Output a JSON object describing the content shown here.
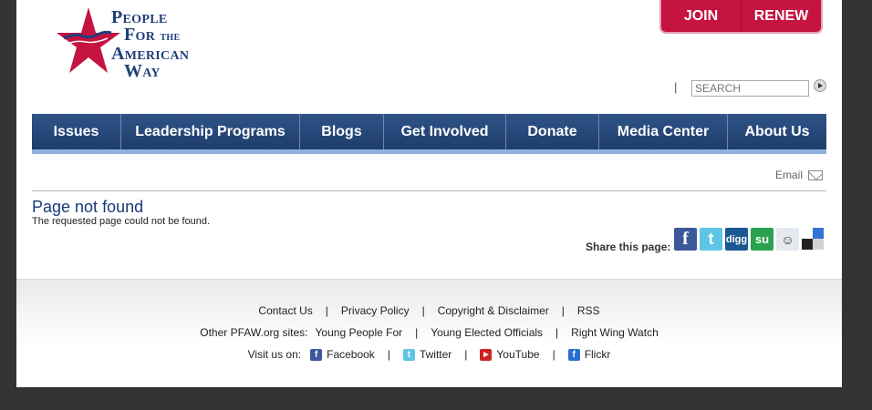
{
  "brand": {
    "line1": "People",
    "line2": "For",
    "line2b": "the",
    "line3": "American",
    "line4": "Way"
  },
  "header": {
    "join_label": "JOIN",
    "renew_label": "RENEW",
    "pipe": "|",
    "search_placeholder": "SEARCH"
  },
  "nav": {
    "items": [
      {
        "label": "Issues"
      },
      {
        "label": "Leadership Programs"
      },
      {
        "label": "Blogs"
      },
      {
        "label": "Get Involved"
      },
      {
        "label": "Donate"
      },
      {
        "label": "Media Center"
      },
      {
        "label": "About Us"
      }
    ]
  },
  "tools": {
    "email_label": "Email"
  },
  "main": {
    "title": "Page not found",
    "message": "The requested page could not be found.",
    "share_label": "Share this page:"
  },
  "share_icons": [
    {
      "name": "facebook-share-icon",
      "glyph": "f"
    },
    {
      "name": "twitter-share-icon",
      "glyph": "t"
    },
    {
      "name": "digg-share-icon",
      "glyph": "digg"
    },
    {
      "name": "stumbleupon-share-icon",
      "glyph": "su"
    },
    {
      "name": "reddit-share-icon",
      "glyph": "☺"
    },
    {
      "name": "delicious-share-icon",
      "glyph": ""
    }
  ],
  "footer": {
    "links": [
      "Contact Us",
      "Privacy Policy",
      "Copyright & Disclaimer",
      "RSS"
    ],
    "other_label": "Other PFAW.org sites:",
    "other_sites": [
      "Young People For",
      "Young Elected Officials",
      "Right Wing Watch"
    ],
    "visit_label": "Visit us on:",
    "social": [
      "Facebook",
      "Twitter",
      "YouTube",
      "Flickr"
    ],
    "separator": "|"
  },
  "colors": {
    "brand_red": "#c4143f",
    "nav_blue": "#2f5488",
    "title_blue": "#1a3a7a"
  }
}
